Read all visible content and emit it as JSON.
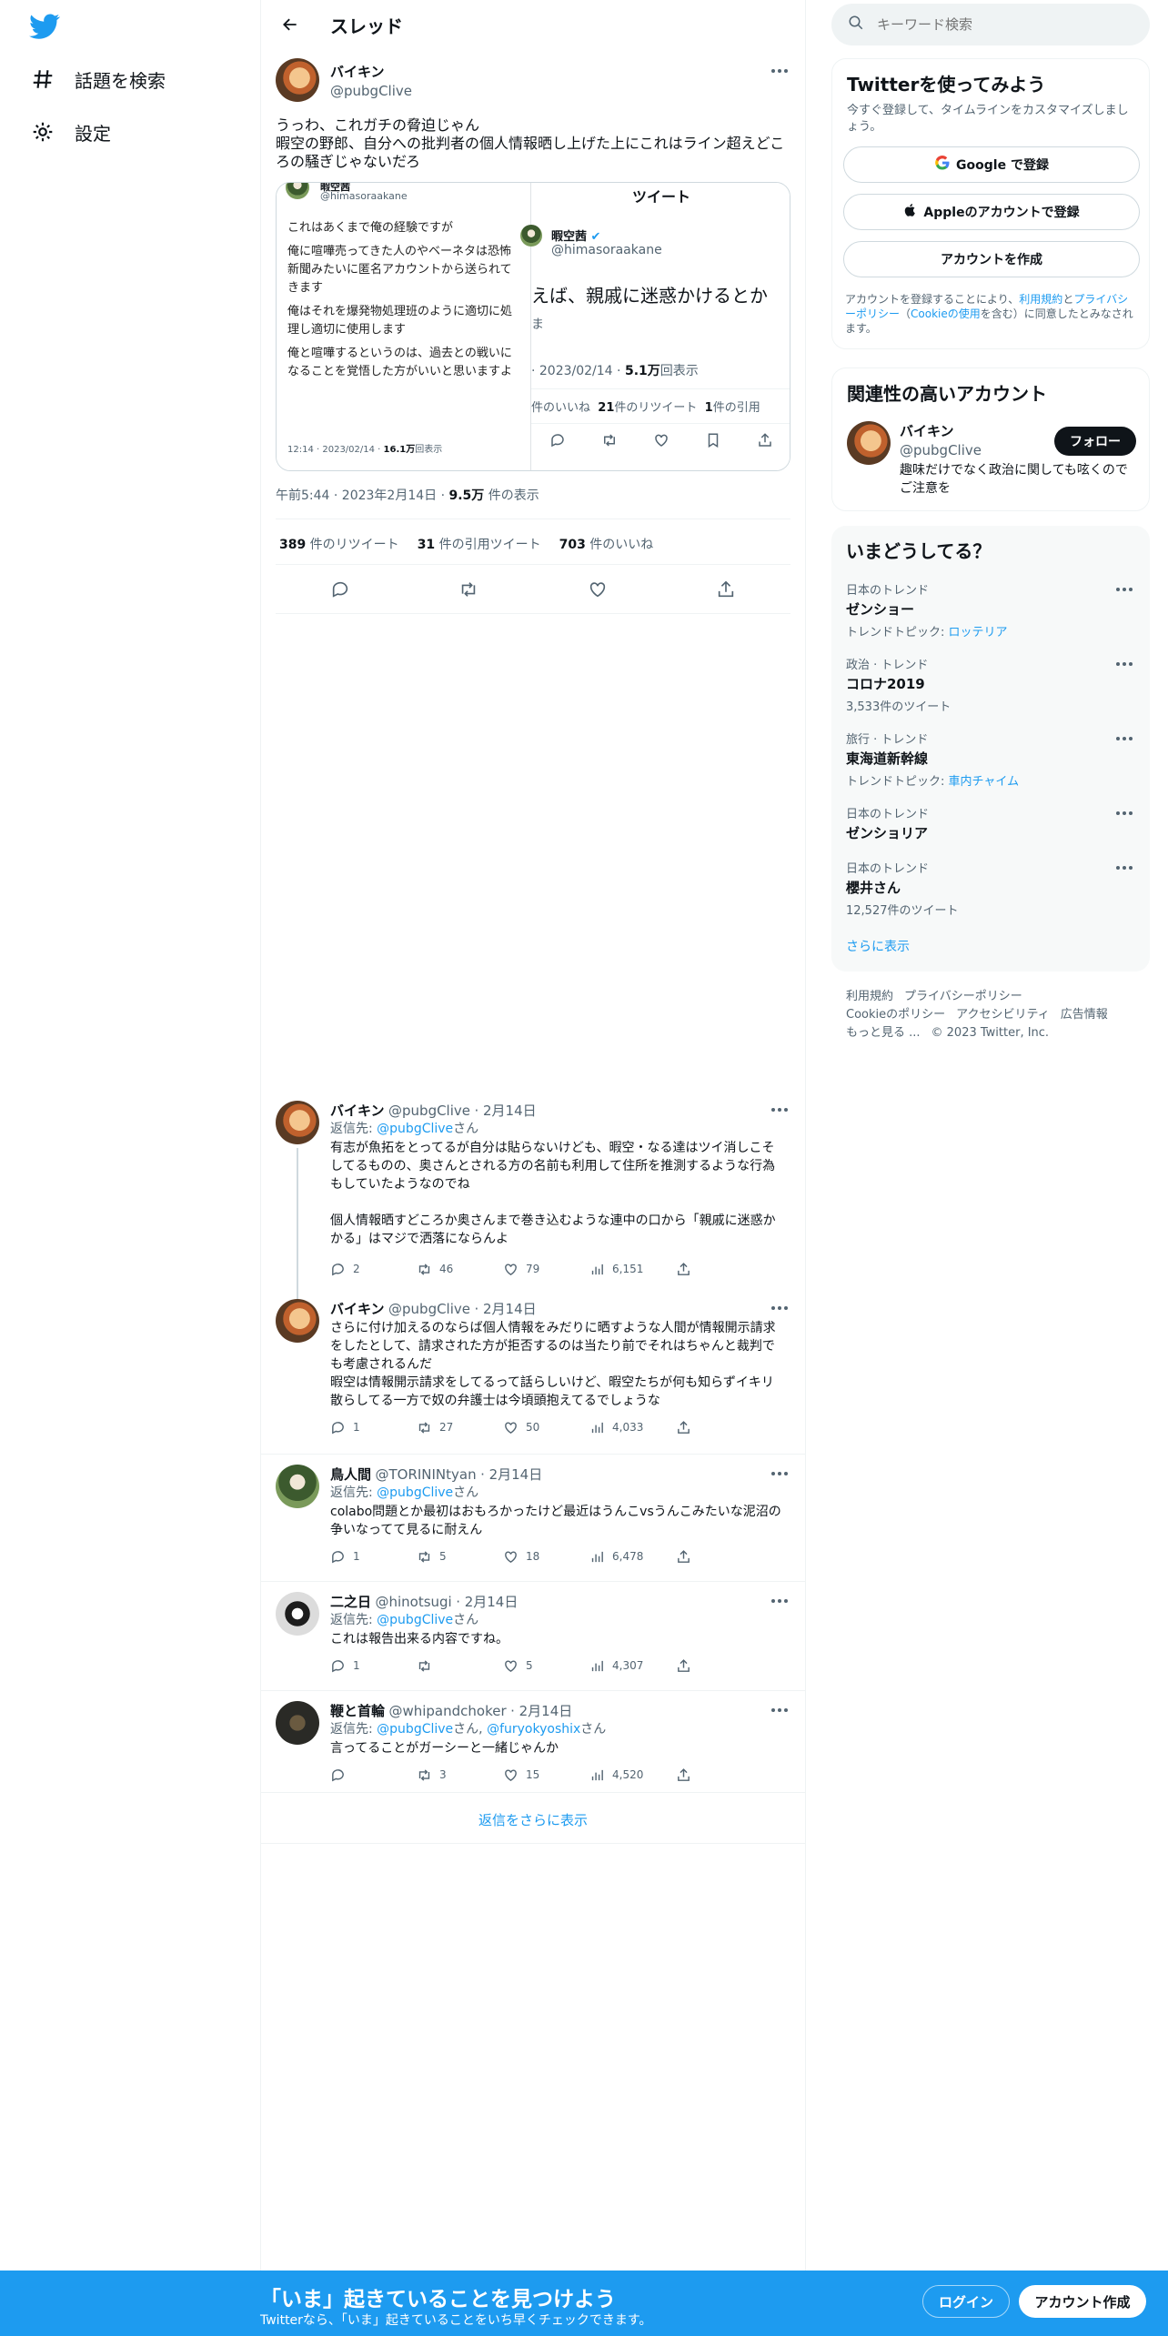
{
  "nav": {
    "items": [
      {
        "label": "話題を検索",
        "icon": "hash-icon"
      },
      {
        "label": "設定",
        "icon": "gear-icon"
      }
    ]
  },
  "header": {
    "title": "スレッド"
  },
  "main_tweet": {
    "name": "バイキン",
    "handle": "@pubgClive",
    "text_lines": [
      "うっわ、これガチの脅迫じゃん",
      "暇空の野郎、自分への批判者の個人情報晒し上げた上にこれはライン超えどころの騒ぎじゃないだろ"
    ],
    "embed_left": {
      "name": "暇空茜",
      "handle": "@himasoraakane",
      "paragraphs": [
        "これはあくまで俺の経験ですが",
        "俺に喧嘩売ってきた人のやベーネタは恐怖新聞みたいに匿名アカウントから送られてきます",
        "俺はそれを爆発物処理班のように適切に処理し適切に使用します",
        "俺と喧嘩するというのは、過去との戦いになることを覚悟した方がいいと思いますよ"
      ],
      "meta_time": "12:14 · 2023/02/14 · ",
      "meta_views": "16.1万",
      "meta_views_suffix": "回表示"
    },
    "embed_right": {
      "header": "ツイート",
      "name": "暇空茜",
      "handle": "@himasoraakane",
      "big_text": "えば、親戚に迷惑かけるとか",
      "date": "· 2023/02/14 · ",
      "views": "5.1万",
      "views_suffix": "回表示",
      "stats_likes": "件のいいね",
      "stats_rt_num": "21",
      "stats_rt": "件のリツイート",
      "stats_quote_num": "1",
      "stats_quote": "件の引用"
    },
    "time": "午前5:44 · 2023年2月14日 · ",
    "views": "9.5万",
    "views_suffix": " 件の表示",
    "retweets": "389",
    "retweets_label": " 件のリツイート",
    "quotes": "31",
    "quotes_label": " 件の引用ツイート",
    "likes": "703",
    "likes_label": " 件のいいね"
  },
  "replies": [
    {
      "name": "バイキン",
      "handle": "@pubgClive",
      "date": "· 2月14日",
      "reply_to_prefix": "返信先: ",
      "reply_to": [
        "@pubgClive"
      ],
      "reply_to_suffix": "さん",
      "text_lines": [
        "有志が魚拓をとってるが自分は貼らないけども、暇空・なる達はツイ消しこそしてるものの、奥さんとされる方の名前も利用して住所を推測するような行為もしていたようなのでね",
        "",
        "個人情報晒すどころか奥さんまで巻き込むような連中の口から「親戚に迷惑かかる」はマジで洒落にならんよ"
      ],
      "replies": "2",
      "retweets": "46",
      "likes": "79",
      "views": "6,151"
    },
    {
      "name": "バイキン",
      "handle": "@pubgClive",
      "date": "· 2月14日",
      "text_lines": [
        "さらに付け加えるのならば個人情報をみだりに晒すような人間が情報開示請求をしたとして、請求された方が拒否するのは当たり前でそれはちゃんと裁判でも考慮されるんだ",
        "暇空は情報開示請求をしてるって話らしいけど、暇空たちが何も知らずイキリ散らしてる一方で奴の弁護士は今頃頭抱えてるでしょうな"
      ],
      "replies": "1",
      "retweets": "27",
      "likes": "50",
      "views": "4,033"
    },
    {
      "name": "鳥人間",
      "handle": "@TORININtyan",
      "date": "· 2月14日",
      "reply_to_prefix": "返信先: ",
      "reply_to": [
        "@pubgClive"
      ],
      "reply_to_suffix": "さん",
      "text_lines": [
        "colabo問題とか最初はおもろかったけど最近はうんこvsうんこみたいな泥沼の争いなってて見るに耐えん"
      ],
      "replies": "1",
      "retweets": "5",
      "likes": "18",
      "views": "6,478"
    },
    {
      "name": "二之日",
      "handle": "@hinotsugi",
      "date": "· 2月14日",
      "reply_to_prefix": "返信先: ",
      "reply_to": [
        "@pubgClive"
      ],
      "reply_to_suffix": "さん",
      "text_lines": [
        "これは報告出来る内容ですね。"
      ],
      "replies": "1",
      "retweets": "",
      "likes": "5",
      "views": "4,307"
    },
    {
      "name": "鞭と首輪",
      "handle": "@whipandchoker",
      "date": "· 2月14日",
      "reply_to_prefix": "返信先: ",
      "reply_to": [
        "@pubgClive",
        "@furyokyoshix"
      ],
      "reply_to_suffix": "さん",
      "text_lines": [
        "言ってることがガーシーと一緒じゃんか"
      ],
      "replies": "",
      "retweets": "3",
      "likes": "15",
      "views": "4,520"
    }
  ],
  "show_more_replies": "返信をさらに表示",
  "search": {
    "placeholder": "キーワード検索"
  },
  "signup_card": {
    "title": "Twitterを使ってみよう",
    "subtitle": "今すぐ登録して、タイムラインをカスタマイズしましょう。",
    "google": "Google で登録",
    "apple": "Appleのアカウントで登録",
    "create": "アカウントを作成",
    "terms_a": "アカウントを登録することにより、",
    "terms_link1": "利用規約",
    "terms_b": "と",
    "terms_link2": "プライバシーポリシー",
    "terms_c": "（",
    "terms_link3": "Cookieの使用",
    "terms_d": "を含む）に同意したとみなされます。"
  },
  "related": {
    "title": "関連性の高いアカウント",
    "name": "バイキン",
    "handle": "@pubgClive",
    "follow": "フォロー",
    "bio": "趣味だけでなく政治に関しても呟くのでご注意を"
  },
  "trends": {
    "title": "いまどうしてる？",
    "items": [
      {
        "category": "日本のトレンド",
        "title": "ゼンショー",
        "sub_prefix": "トレンドトピック: ",
        "sub_link": "ロッテリア",
        "sub": ""
      },
      {
        "category": "政治 · トレンド",
        "title": "コロナ2019",
        "sub_prefix": "",
        "sub_link": "",
        "sub": "3,533件のツイート"
      },
      {
        "category": "旅行 · トレンド",
        "title": "東海道新幹線",
        "sub_prefix": "トレンドトピック: ",
        "sub_link": "車内チャイム",
        "sub": ""
      },
      {
        "category": "日本のトレンド",
        "title": "ゼンショリア",
        "sub_prefix": "",
        "sub_link": "",
        "sub": ""
      },
      {
        "category": "日本のトレンド",
        "title": "櫻井さん",
        "sub_prefix": "",
        "sub_link": "",
        "sub": "12,527件のツイート"
      }
    ],
    "show_more": "さらに表示"
  },
  "footer": {
    "links": [
      "利用規約",
      "プライバシーポリシー",
      "Cookieのポリシー",
      "アクセシビリティ",
      "広告情報",
      "もっと見る ..."
    ],
    "copyright": "© 2023 Twitter, Inc."
  },
  "bottom_bar": {
    "title": "「いま」起きていることを見つけよう",
    "subtitle": "Twitterなら、「いま」起きていることをいち早くチェックできます。",
    "login": "ログイン",
    "signup": "アカウント作成"
  },
  "colors": {
    "accent": "#1d9bf0",
    "text": "#0f1419",
    "muted": "#536471"
  }
}
